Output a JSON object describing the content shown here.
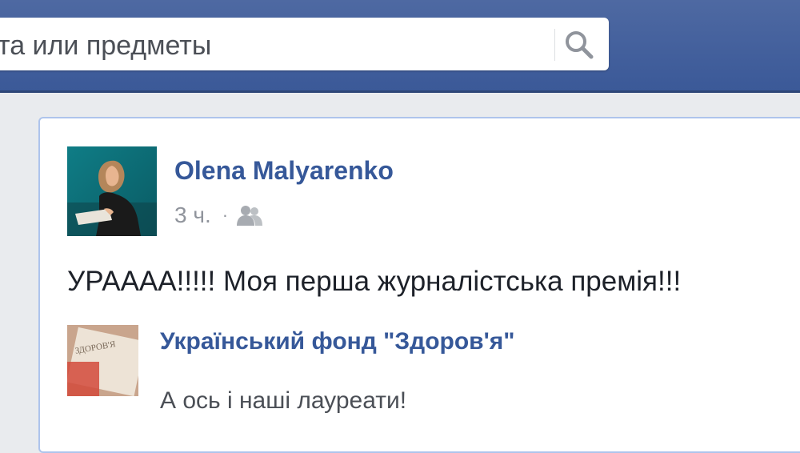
{
  "search": {
    "value": "ста или предметы"
  },
  "post": {
    "author": "Olena Malyarenko",
    "timestamp": "3 ч.",
    "separator": "·",
    "audience_icon": "friends-icon",
    "text": "УРАААА!!!!! Моя перша журналістська премія!!!"
  },
  "shared": {
    "title": "Український фонд \"Здоров'я\"",
    "description": "А ось і наші лауреати!",
    "thumbnail_text": "ЗДОРОВ'Я"
  },
  "colors": {
    "topbar": "#3b5998",
    "link": "#365899",
    "card_border": "#aec4ec",
    "muted": "#90949c"
  }
}
